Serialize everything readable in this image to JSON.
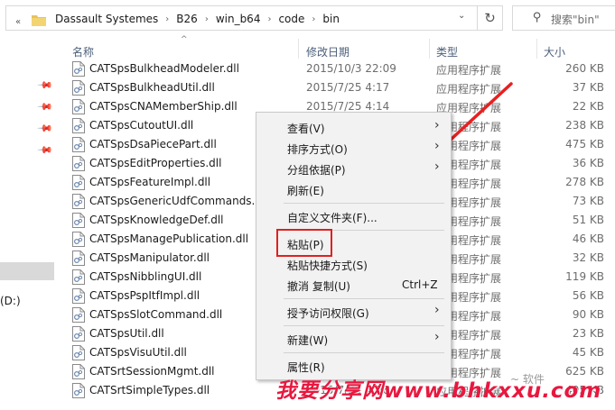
{
  "address": {
    "overflow": "«",
    "crumbs": [
      "Dassault Systemes",
      "B26",
      "win_b64",
      "code",
      "bin"
    ],
    "search_placeholder": "搜索\"bin\""
  },
  "nav": {
    "drive_label": "(D:)"
  },
  "columns": {
    "name": "名称",
    "date": "修改日期",
    "type": "类型",
    "size": "大小"
  },
  "files": [
    {
      "name": "CATSpsBulkheadModeler.dll",
      "date": "2015/10/3 22:09",
      "type": "应用程序扩展",
      "size": "260 KB"
    },
    {
      "name": "CATSpsBulkheadUtil.dll",
      "date": "2015/7/25 4:17",
      "type": "应用程序扩展",
      "size": "37 KB"
    },
    {
      "name": "CATSpsCNAMemberShip.dll",
      "date": "2015/7/25 4:14",
      "type": "应用程序扩展",
      "size": "22 KB"
    },
    {
      "name": "CATSpsCutoutUI.dll",
      "date": "",
      "type": "应用程序扩展",
      "size": "238 KB"
    },
    {
      "name": "CATSpsDsaPiecePart.dll",
      "date": "",
      "type": "应用程序扩展",
      "size": "475 KB"
    },
    {
      "name": "CATSpsEditProperties.dll",
      "date": "",
      "type": "应用程序扩展",
      "size": "36 KB"
    },
    {
      "name": "CATSpsFeatureImpl.dll",
      "date": "",
      "type": "应用程序扩展",
      "size": "278 KB"
    },
    {
      "name": "CATSpsGenericUdfCommands.dll",
      "date": "",
      "type": "应用程序扩展",
      "size": "73 KB"
    },
    {
      "name": "CATSpsKnowledgeDef.dll",
      "date": "",
      "type": "应用程序扩展",
      "size": "51 KB"
    },
    {
      "name": "CATSpsManagePublication.dll",
      "date": "",
      "type": "应用程序扩展",
      "size": "46 KB"
    },
    {
      "name": "CATSpsManipulator.dll",
      "date": "",
      "type": "应用程序扩展",
      "size": "32 KB"
    },
    {
      "name": "CATSpsNibblingUI.dll",
      "date": "",
      "type": "应用程序扩展",
      "size": "119 KB"
    },
    {
      "name": "CATSpsPspItfImpl.dll",
      "date": "",
      "type": "应用程序扩展",
      "size": "56 KB"
    },
    {
      "name": "CATSpsSlotCommand.dll",
      "date": "",
      "type": "应用程序扩展",
      "size": "90 KB"
    },
    {
      "name": "CATSpsUtil.dll",
      "date": "",
      "type": "应用程序扩展",
      "size": "23 KB"
    },
    {
      "name": "CATSpsVisuUtil.dll",
      "date": "",
      "type": "应用程序扩展",
      "size": "45 KB"
    },
    {
      "name": "CATSrtSessionMgmt.dll",
      "date": "",
      "type": "应用程序扩展",
      "size": "625 KB"
    },
    {
      "name": "CATSrtSimpleTypes.dll",
      "date": "2015/7/25 4:26",
      "type": "应用程序扩展",
      "size": "405 KB"
    }
  ],
  "context_menu": {
    "view": "查看(V)",
    "sort": "排序方式(O)",
    "group": "分组依据(P)",
    "refresh": "刷新(E)",
    "customize": "自定义文件夹(F)...",
    "paste": "粘贴(P)",
    "paste_shortcut": "粘贴快捷方式(S)",
    "undo_copy": "撤消 复制(U)",
    "undo_shortcut": "Ctrl+Z",
    "give_access": "授予访问权限(G)",
    "new": "新建(W)",
    "properties": "属性(R)"
  },
  "watermark": {
    "text": "我要分享网www.bhkxxu.com",
    "faint": "~ 软件"
  },
  "colors": {
    "highlight_red": "#e02020",
    "watermark_red": "#e8183f",
    "menu_bg": "#f2f2f2"
  },
  "icons": [
    "chevron-left-double-icon",
    "folder-icon",
    "refresh-icon",
    "search-icon",
    "pin-icon",
    "dll-file-icon",
    "submenu-arrow-icon",
    "red-arrow-icon"
  ]
}
